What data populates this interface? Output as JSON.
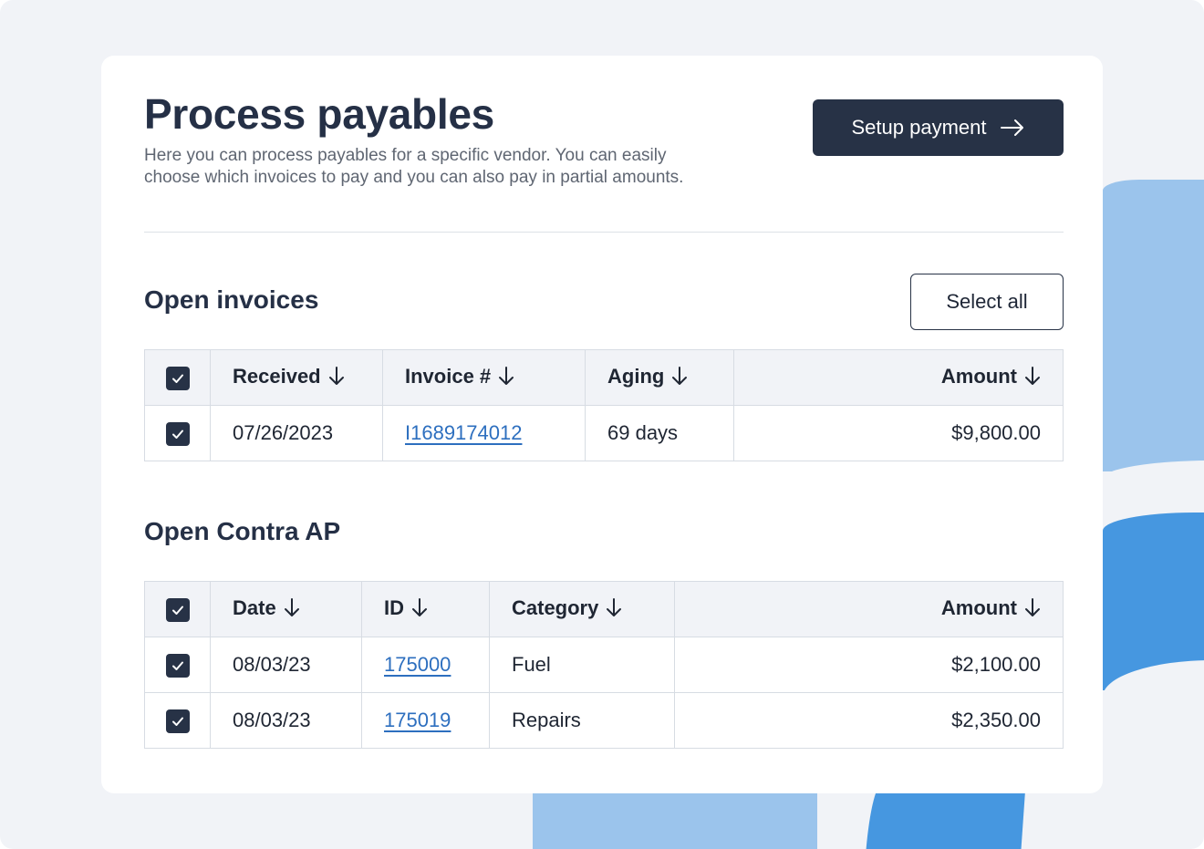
{
  "header": {
    "title": "Process payables",
    "description": "Here you can process payables for a specific vendor. You can easily choose which invoices to pay and you can also pay in partial amounts.",
    "setup_button": "Setup payment"
  },
  "invoices": {
    "title": "Open invoices",
    "select_all": "Select all",
    "columns": [
      "Received",
      "Invoice #",
      "Aging",
      "Amount"
    ],
    "rows": [
      {
        "received": "07/26/2023",
        "invoice": "I1689174012",
        "aging": "69 days",
        "amount": "$9,800.00",
        "checked": true
      }
    ]
  },
  "contra": {
    "title": "Open Contra AP",
    "columns": [
      "Date",
      "ID",
      "Category",
      "Amount"
    ],
    "rows": [
      {
        "date": "08/03/23",
        "id": "175000",
        "category": "Fuel",
        "amount": "$2,100.00",
        "checked": true
      },
      {
        "date": "08/03/23",
        "id": "175019",
        "category": "Repairs",
        "amount": "$2,350.00",
        "checked": true
      }
    ]
  },
  "colors": {
    "primary": "#273246",
    "link": "#2d6fbf",
    "accent_light": "#9bc4ec",
    "accent_dark": "#4697e0"
  }
}
